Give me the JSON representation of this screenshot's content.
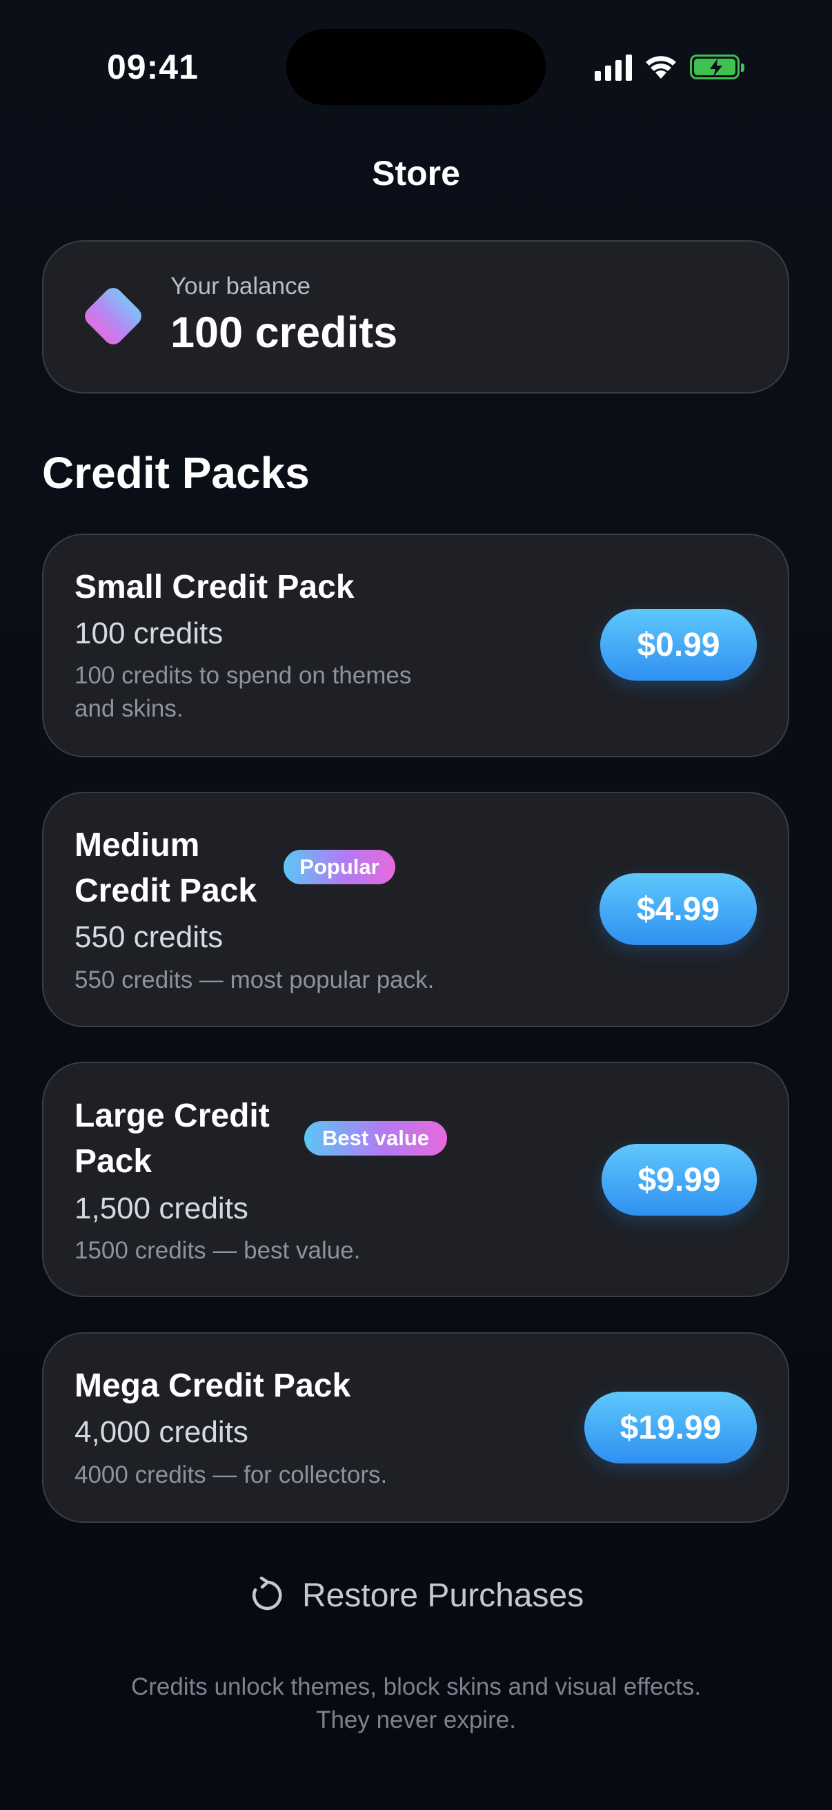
{
  "status_bar": {
    "time": "09:41"
  },
  "nav": {
    "title": "Store"
  },
  "balance": {
    "label": "Your balance",
    "value": "100 credits",
    "icon": "gem-icon"
  },
  "section": {
    "title": "Credit Packs"
  },
  "packs": [
    {
      "title_line1": "Small Credit Pack",
      "title_line2": "",
      "credits": "100 credits",
      "desc_line1": "100 credits to spend on themes",
      "desc_line2": "and skins.",
      "price": "$0.99",
      "badge": ""
    },
    {
      "title_line1": "Medium",
      "title_line2": "Credit Pack",
      "credits": "550 credits",
      "desc_line1": "550 credits — most popular pack.",
      "desc_line2": "",
      "price": "$4.99",
      "badge": "Popular"
    },
    {
      "title_line1": "Large Credit",
      "title_line2": "Pack",
      "credits": "1,500 credits",
      "desc_line1": "1500 credits — best value.",
      "desc_line2": "",
      "price": "$9.99",
      "badge": "Best value"
    },
    {
      "title_line1": "Mega Credit Pack",
      "title_line2": "",
      "credits": "4,000 credits",
      "desc_line1": "4000 credits — for collectors.",
      "desc_line2": "",
      "price": "$19.99",
      "badge": ""
    }
  ],
  "restore": {
    "label": "Restore Purchases",
    "icon": "refresh-icon"
  },
  "footer": {
    "line1": "Credits unlock themes, block skins and visual effects.",
    "line2": "They never expire."
  },
  "colors": {
    "background": "#090c14",
    "card": "#1e2025",
    "accent_blue": "#2f90f1",
    "battery_green": "#3fc150"
  }
}
